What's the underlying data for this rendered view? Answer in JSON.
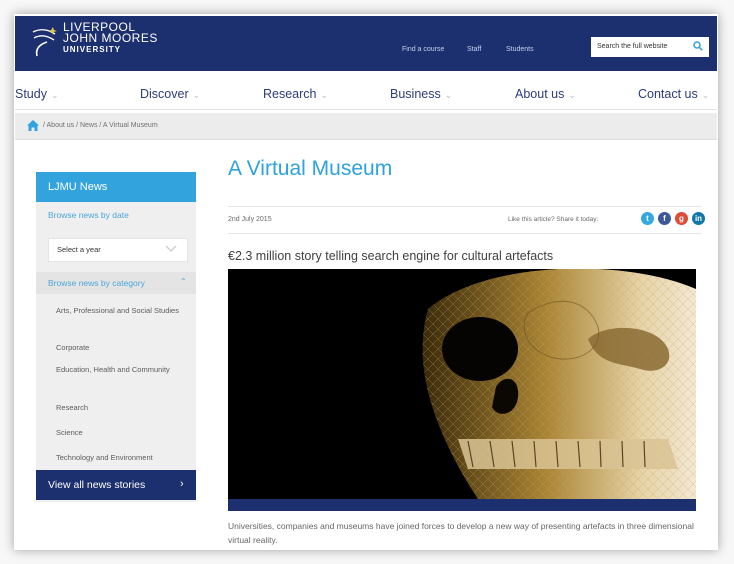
{
  "header": {
    "logo_lines": [
      "LIVERPOOL",
      "JOHN MOORES",
      "UNIVERSITY"
    ],
    "links": [
      "Find a course",
      "Staff",
      "Students"
    ],
    "search_placeholder": "Search the full website"
  },
  "nav": [
    "Study",
    "Discover",
    "Research",
    "Business",
    "About us",
    "Contact us"
  ],
  "breadcrumb": "/ About us / News / A Virtual Museum",
  "sidebar": {
    "title": "LJMU News",
    "browse_date": "Browse news by date",
    "year_select": "Select a year",
    "browse_category": "Browse news by category",
    "categories": [
      "Arts, Professional and Social Studies",
      "Corporate",
      "Education, Health and Community",
      "Research",
      "Science",
      "Technology and Environment"
    ],
    "view_all": "View all news stories"
  },
  "article": {
    "title": "A Virtual Museum",
    "date": "2nd July 2015",
    "share_text": "Like this article? Share it today:",
    "subtitle": "€2.3 million story telling search engine for cultural artefacts",
    "caption": "Universities, companies and museums have joined forces to develop a new way of presenting artefacts in three dimensional virtual reality."
  },
  "colors": {
    "navy": "#1c2f6e",
    "accent_blue": "#33a3de",
    "twitter": "#35a8e0",
    "facebook": "#3b5998",
    "google": "#dd4b39",
    "linkedin": "#0e76a8"
  },
  "icons": [
    "search-icon",
    "home-icon",
    "chevron-down-icon",
    "chevron-up-icon",
    "arrow-right-icon",
    "twitter-icon",
    "facebook-icon",
    "google-plus-icon",
    "linkedin-icon"
  ]
}
